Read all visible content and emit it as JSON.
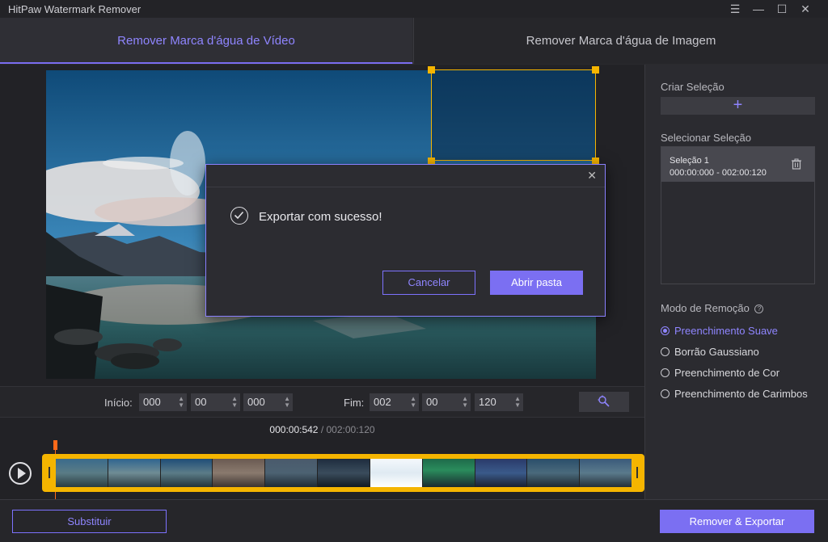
{
  "app": {
    "title": "HitPaw Watermark Remover"
  },
  "window_controls": {
    "menu": "☰",
    "minimize": "—",
    "maximize": "☐",
    "close": "✕"
  },
  "tabs": [
    {
      "label": "Remover Marca d'água de Vídeo",
      "active": true
    },
    {
      "label": "Remover Marca d'água de Imagem",
      "active": false
    }
  ],
  "dialog": {
    "message": "Exportar com sucesso!",
    "cancel_label": "Cancelar",
    "open_label": "Abrir pasta",
    "close_glyph": "✕"
  },
  "time_range": {
    "start_label": "Início:",
    "start": [
      "000",
      "00",
      "000"
    ],
    "end_label": "Fim:",
    "end": [
      "002",
      "00",
      "120"
    ]
  },
  "playback": {
    "current": "000:00:542",
    "separator": " / ",
    "total": "002:00:120"
  },
  "panel": {
    "create_title": "Criar Seleção",
    "add_glyph": "+",
    "select_title": "Selecionar Seleção",
    "selections": [
      {
        "name": "Seleção 1",
        "range": "000:00:000 - 002:00:120"
      }
    ],
    "mode_title": "Modo de Remoção",
    "help_glyph": "?",
    "modes": [
      {
        "label": "Preenchimento Suave",
        "selected": true
      },
      {
        "label": "Borrão Gaussiano",
        "selected": false
      },
      {
        "label": "Preenchimento de Cor",
        "selected": false
      },
      {
        "label": "Preenchimento de Carimbos",
        "selected": false
      }
    ]
  },
  "bottom": {
    "replace_label": "Substituir",
    "export_label": "Remover & Exportar"
  },
  "colors": {
    "accent": "#7b6ff2",
    "selection": "#f5b500",
    "playhead": "#ff6a1a"
  },
  "icons": {
    "check": "check-circle-icon",
    "trash": "trash-icon",
    "play": "play-icon",
    "magic": "magic-wand-icon"
  }
}
